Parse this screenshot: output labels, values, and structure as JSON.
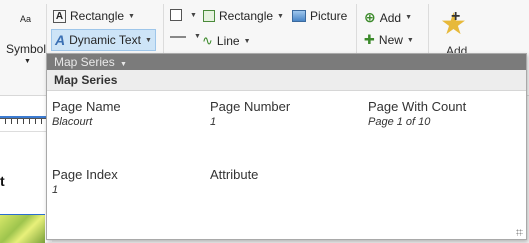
{
  "ribbon": {
    "aa_label": "Aa",
    "symbol_label": "Symbol",
    "rectangle_text_label": "Rectangle",
    "dynamic_text_label": "Dynamic Text",
    "shape_rectangle_label": "Rectangle",
    "picture_label": "Picture",
    "line_label": "Line",
    "add_label": "Add",
    "new_label": "New",
    "add_big_label": "Add"
  },
  "doc": {
    "fragment_text": "t"
  },
  "popup": {
    "title": "Map Series",
    "section": "Map Series",
    "fields": [
      {
        "name": "Page Name",
        "value": "Blacourt"
      },
      {
        "name": "Page Number",
        "value": "1"
      },
      {
        "name": "Page With Count",
        "value": "Page 1 of 10"
      },
      {
        "name": "Page Index",
        "value": "1"
      },
      {
        "name": "Attribute",
        "value": ""
      }
    ]
  },
  "colors": {
    "highlight": "#cde4f7",
    "popup_header": "#7b7b7b",
    "star": "#e7b93a"
  }
}
